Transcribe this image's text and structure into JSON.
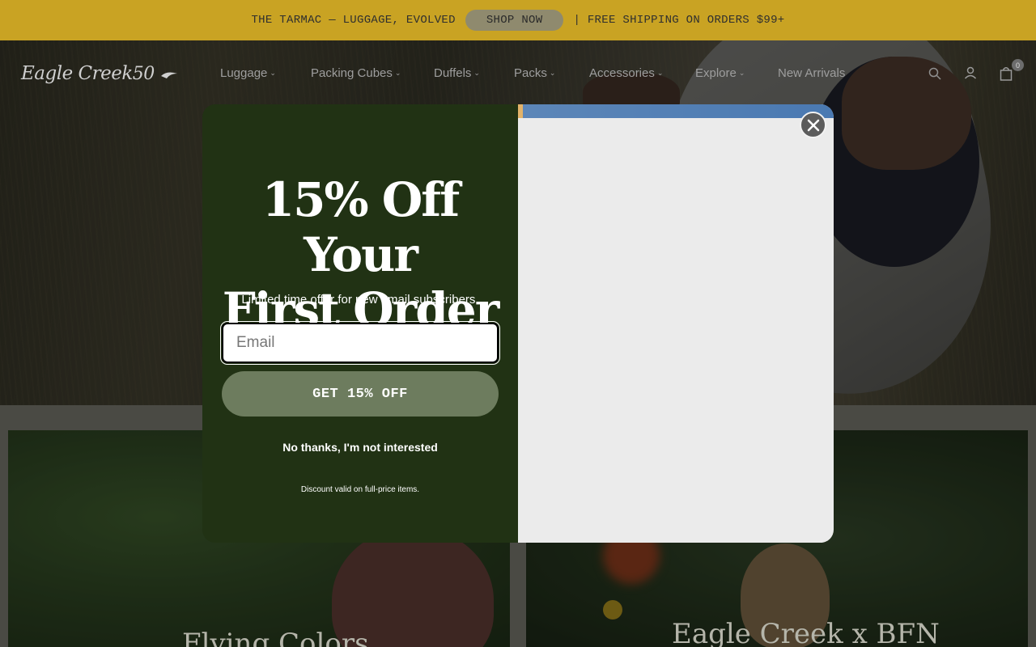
{
  "announcement": {
    "left_text": "THE TARMAC — LUGGAGE, EVOLVED",
    "button_label": "SHOP NOW",
    "right_text": "| FREE SHIPPING ON ORDERS $99+"
  },
  "header": {
    "logo_text": "Eagle Creek",
    "logo_years": "50",
    "nav": [
      {
        "label": "Luggage"
      },
      {
        "label": "Packing Cubes"
      },
      {
        "label": "Duffels"
      },
      {
        "label": "Packs"
      },
      {
        "label": "Accessories"
      },
      {
        "label": "Explore"
      },
      {
        "label": "New Arrivals"
      }
    ],
    "cart_count": "0",
    "icons": [
      "search-icon",
      "account-icon",
      "cart-icon"
    ]
  },
  "cards": [
    {
      "title": "Flying Colors"
    },
    {
      "title": "Eagle Creek x BFN"
    }
  ],
  "modal": {
    "headline_line1": "15% Off Your",
    "headline_line2": "First Order",
    "subline": "Limited time offer for new email subscribers.",
    "email_placeholder": "Email",
    "cta_label": "GET 15% OFF",
    "decline_label": "No thanks, I'm not interested",
    "disclaimer": "Discount valid on full-price items."
  },
  "colors": {
    "announcement_bg": "#c9a323",
    "modal_left_bg": "#213214",
    "cta_bg": "#6d7c5e",
    "modal_right_bg": "#ebebeb"
  }
}
